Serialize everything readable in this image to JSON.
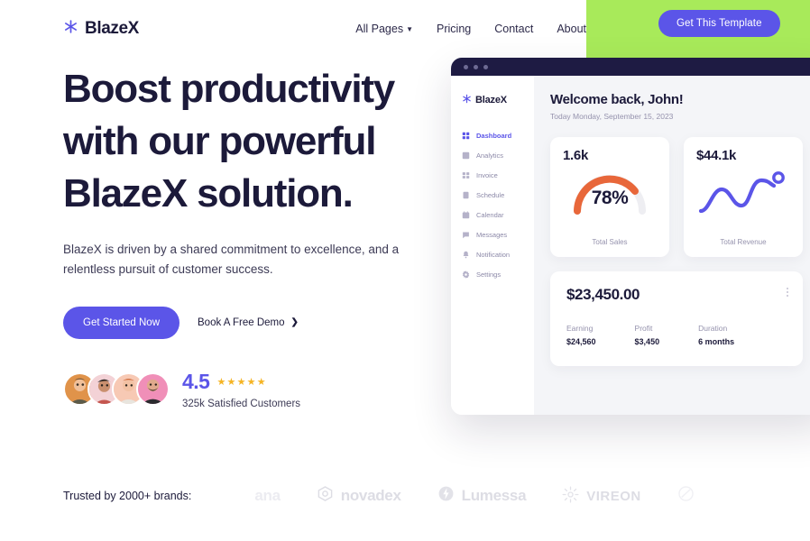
{
  "promo": {
    "button_label": "Get This Template",
    "banner_color": "#a8ea5a",
    "accent": "#5b55e8"
  },
  "nav": {
    "brand": "BlazeX",
    "logo_icon": "asterisk-icon",
    "links": [
      {
        "label": "All Pages",
        "has_chevron": true
      },
      {
        "label": "Pricing",
        "has_chevron": false
      },
      {
        "label": "Contact",
        "has_chevron": false
      },
      {
        "label": "About",
        "has_chevron": false
      }
    ]
  },
  "hero": {
    "headline": "Boost productivity with our powerful BlazeX solution.",
    "subhead": "BlazeX is driven by a shared commitment to excellence, and a relentless pursuit of customer success.",
    "primary_cta": "Get Started Now",
    "secondary_cta": "Book A Free Demo",
    "secondary_arrow": "❯"
  },
  "rating": {
    "score": "4.5",
    "stars": "★★★★★",
    "caption": "325k Satisfied Customers",
    "avatar_colors": [
      "#e0934a",
      "#f3d2d6",
      "#f7c9b4",
      "#f08fb8"
    ]
  },
  "dashboard": {
    "brand": "BlazeX",
    "welcome": "Welcome back, John!",
    "date": "Today Monday, September 15, 2023",
    "sidebar": [
      {
        "label": "Dashboard",
        "icon": "grid-icon",
        "active": true
      },
      {
        "label": "Analytics",
        "icon": "chart-icon",
        "active": false
      },
      {
        "label": "Invoice",
        "icon": "invoice-icon",
        "active": false
      },
      {
        "label": "Schedule",
        "icon": "schedule-icon",
        "active": false
      },
      {
        "label": "Calendar",
        "icon": "calendar-icon",
        "active": false
      },
      {
        "label": "Messages",
        "icon": "message-icon",
        "active": false
      },
      {
        "label": "Notification",
        "icon": "bell-icon",
        "active": false
      },
      {
        "label": "Settings",
        "icon": "gear-icon",
        "active": false
      }
    ],
    "stats": [
      {
        "value": "1.6k",
        "percent": "78%",
        "label": "Total Sales",
        "color": "#e8673a"
      },
      {
        "value": "$44.1k",
        "label": "Total Revenue",
        "color": "#5b55e8"
      }
    ],
    "summary": {
      "total": "$23,450.00",
      "metrics": [
        {
          "name": "Earning",
          "figure": "$24,560"
        },
        {
          "name": "Profit",
          "figure": "$3,450"
        },
        {
          "name": "Duration",
          "figure": "6 months"
        }
      ]
    }
  },
  "brands": {
    "label": "Trusted by 2000+ brands:",
    "logos": [
      {
        "name": "ana",
        "icon": "none"
      },
      {
        "name": "novadex",
        "icon": "hexagon-icon"
      },
      {
        "name": "Lumessa",
        "icon": "bolt-circle-icon"
      },
      {
        "name": "VIREON",
        "icon": "sunburst-icon"
      },
      {
        "name": "",
        "icon": "circle-slash-icon"
      }
    ]
  }
}
